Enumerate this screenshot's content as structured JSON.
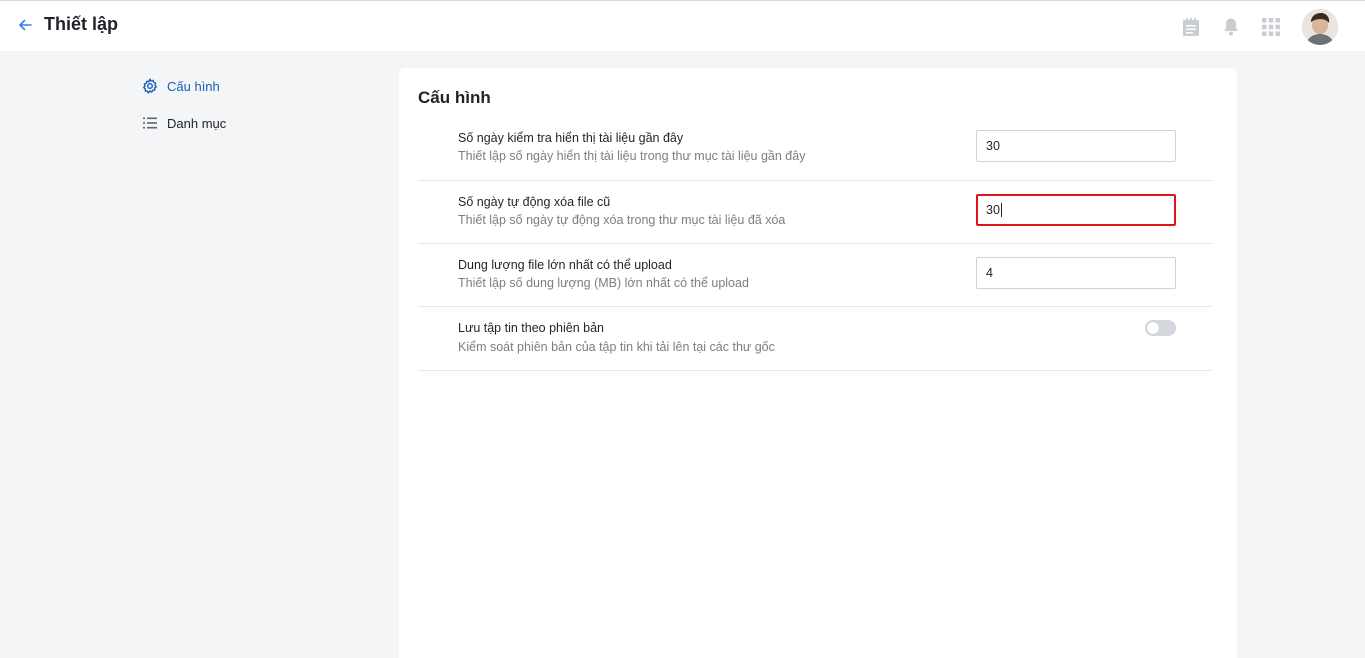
{
  "header": {
    "title": "Thiết lập",
    "icons": [
      "back-arrow-icon",
      "notepad-icon",
      "bell-icon",
      "app-grid-icon",
      "avatar"
    ]
  },
  "sidebar": {
    "items": [
      {
        "label": "Cấu hình",
        "icon": "gear-icon",
        "active": true
      },
      {
        "label": "Danh mục",
        "icon": "list-icon",
        "active": false
      }
    ]
  },
  "main": {
    "title": "Cấu hình",
    "settings": [
      {
        "title": "Số ngày kiểm tra hiển thị tài liệu gần đây",
        "description": "Thiết lập số ngày hiển thị tài liệu trong thư mục tài liệu gần đây",
        "value": "30"
      },
      {
        "title": "Số ngày tự động xóa file cũ",
        "description": "Thiết lập số ngày tự động xóa trong thư mục tài liệu đã xóa",
        "value": "30"
      },
      {
        "title": "Dung lượng file lớn nhất có thể upload",
        "description": "Thiết lập số dung lượng (MB) lớn nhất có thể upload",
        "value": "4"
      },
      {
        "title": "Lưu tập tin theo phiên bản",
        "description": "Kiểm soát phiên bản của tập tin khi tải lên tại các thư gốc",
        "toggle": false
      }
    ]
  },
  "colors": {
    "accent": "#1a5fb4",
    "focus_border": "#e0141e",
    "background": "#f4f5f7"
  }
}
